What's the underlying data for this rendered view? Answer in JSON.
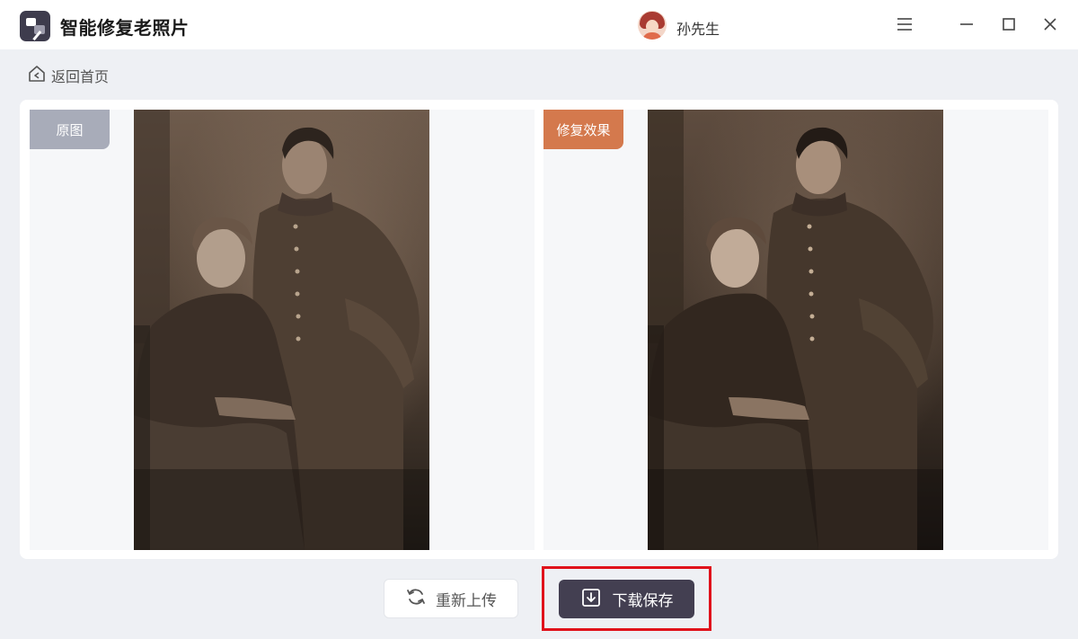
{
  "app": {
    "title": "智能修复老照片",
    "icon": "photo-restore-logo"
  },
  "user": {
    "name": "孙先生",
    "avatar_icon": "user-avatar"
  },
  "window_controls": {
    "menu_icon": "hamburger-menu-icon",
    "minimize_icon": "minimize-icon",
    "maximize_icon": "maximize-icon",
    "close_icon": "close-icon"
  },
  "nav": {
    "back_label": "返回首页",
    "back_icon": "home-icon"
  },
  "compare": {
    "original_label": "原图",
    "result_label": "修复效果",
    "original_tag_color": "#a8acb9",
    "result_tag_color": "#d4794d"
  },
  "actions": {
    "reupload_label": "重新上传",
    "reupload_icon": "refresh-icon",
    "download_label": "下载保存",
    "download_icon": "download-icon",
    "highlight_color": "#e0121b"
  }
}
